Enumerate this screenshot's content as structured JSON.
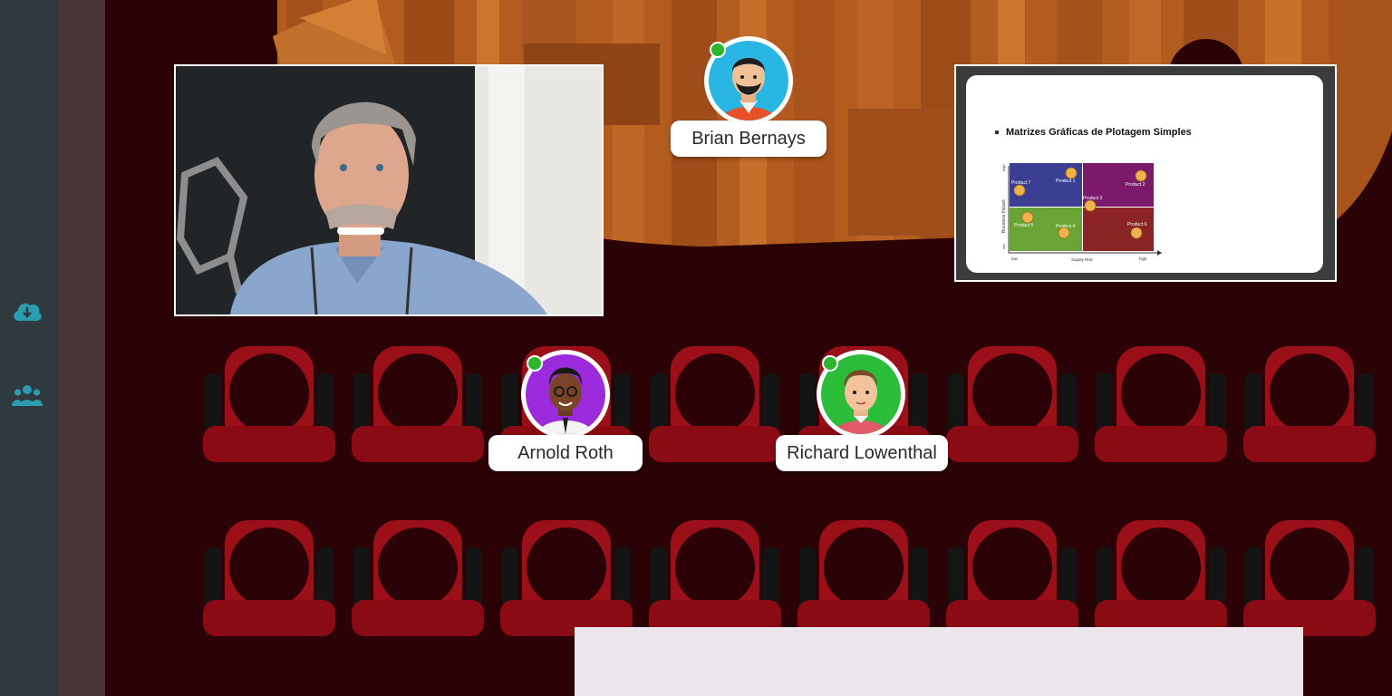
{
  "sidebar": {
    "items": [
      {
        "icon": "cloud-download-icon"
      },
      {
        "icon": "users-group-icon"
      }
    ]
  },
  "colors": {
    "accent": "#2a9db3",
    "online": "#2bb52b",
    "seat": "#8b0b14",
    "stage": "#b05a1e"
  },
  "speaker": {
    "name": "Brian Bernays",
    "online": true
  },
  "audience": [
    {
      "name": "Arnold Roth",
      "online": true
    },
    {
      "name": "Richard Lowenthal",
      "online": true
    }
  ],
  "presentation": {
    "bullet": "Matrizes Gráficas de Plotagem Simples",
    "matrix": {
      "y_axis": "Business Impact",
      "y_high": "high",
      "y_low": "low",
      "x_axis": "Supply Risk",
      "x_low": "low",
      "x_high": "high",
      "products": [
        "Product 1",
        "Product 2",
        "Product 3",
        "Product 4",
        "Product 5",
        "Product 6",
        "Product 7"
      ]
    }
  }
}
